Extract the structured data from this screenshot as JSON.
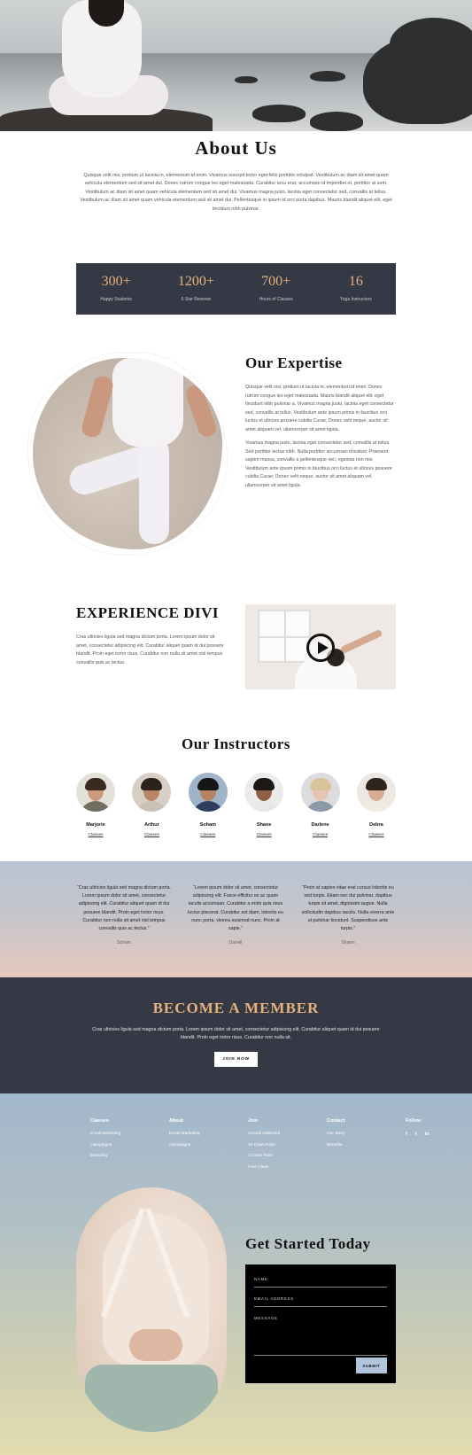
{
  "about": {
    "title": "About Us",
    "text": "Quisque velit nisi, pretium ut lacinia in, elementum id enim. Vivamus suscipit tortor eget felis porttitor volutpat. Vestibulum ac diam sit amet quam vehicula elementum sed sit amet dui. Donec rutrum congue leo eget malesuada. Curabitur arcu erat, accumsan id imperdiet et, porttitor at sem. Vestibulum ac diam sit amet quam vehicula elementum sed sit amet dui. Vivamus magna justo, lacinia eget consectetur sed, convallis at tellus. Vestibulum ac diam sit amet quam vehicula elementum sed sit amet dui. Pellentesque in ipsum id orci porta dapibus. Mauris blandit aliquet elit, eget tincidunt nibh pulvinar."
  },
  "stats": [
    {
      "number": "300+",
      "label": "Happy Students"
    },
    {
      "number": "1200+",
      "label": "5 Star Reviews"
    },
    {
      "number": "700+",
      "label": "Hours of Classes"
    },
    {
      "number": "16",
      "label": "Yoga Instructors"
    }
  ],
  "expertise": {
    "title": "Our Expertise",
    "p1": "Quisque velit nisi, pretium ut lacinia in, elementum id enim. Donec rutrum congue leo eget malesuada. Mauris blandit aliquet elit, eget tincidunt nibh pulvinar a. Vivamus magna justo, lacinia eget consectetur sed, convallis at tellus. Vestibulum ante ipsum primis in faucibus orci luctus et ultrices posuere cubilia Curae; Donec velit neque, auctor sit amet aliquam vel, ullamcorper sit amet ligula.",
    "p2": "Vivamus magna justo, lacinia eget consectetur sed, convallis at tellus. Sed porttitor lectus nibh. Nulla porttitor accumsan tincidunt. Praesent sapien massa, convallis a pellentesque nec, egestas non nisi. Vestibulum ante ipsum primis in faucibus orci luctus et ultrices posuere cubilia Curae; Donec velit neque, auctor sit amet aliquam vel, ullamcorper sit amet ligula."
  },
  "experience": {
    "title": "Experience Divi",
    "text": "Cras ultricies ligula sed magna dictum porta. Lorem ipsum dolor sit amet, consectetur adipiscing elit. Curabitur aliquet quam id dui posuere blandit. Proin eget tortor risus. Curabitur non nulla sit amet nisl tempus convallis quis ac lectus."
  },
  "instructors": {
    "title": "Our Instructors",
    "link_label": "Classes",
    "people": [
      {
        "name": "Marjorie",
        "skin": "#c99a7e",
        "hair": "#3a2a20",
        "shirt": "#6f6e5f",
        "bg": "#e4e1da"
      },
      {
        "name": "Arthur",
        "skin": "#b98565",
        "hair": "#2b221d",
        "shirt": "#c9c2b4",
        "bg": "#d7cfc3"
      },
      {
        "name": "Soham",
        "skin": "#b88363",
        "hair": "#161616",
        "shirt": "#2f3e5e",
        "bg": "#9fb3c9"
      },
      {
        "name": "Shane",
        "skin": "#8e5f45",
        "hair": "#1e1714",
        "shirt": "#e9e6e6",
        "bg": "#ecebec"
      },
      {
        "name": "Darlene",
        "skin": "#e6c4b0",
        "hair": "#d9c39b",
        "shirt": "#8a9aa8",
        "bg": "#dcdcde"
      },
      {
        "name": "Debra",
        "skin": "#d8ab93",
        "hair": "#2e231d",
        "shirt": "#f1ebe6",
        "bg": "#eee8e3"
      }
    ]
  },
  "testimonials": [
    {
      "quote": "“Cras ultricies ligula sed magna dictum porta. Lorem ipsum dolor sit amet, consectetur adipiscing elit. Curabitur aliquet quam id dui posuere blandit. Proin eget tortor risus. Curabitur non nulla sit amet nisl tempus convallis quis ac lectus.”",
      "name": "Soham"
    },
    {
      "quote": "“Lorem ipsum dolor sit amet, consectetur adipiscing elit. Fusce efficitur ex ac quam iaculis accumsan. Curabitur a enim quis risus luctus placerat. Curabitur est diam, lobortis eu nunc porta, viverra euismod nunc. Proin at sapie.”",
      "name": "Darrell"
    },
    {
      "quote": "“Proin at sapien vitae erat cursus lobortis eu sed turpis. Etiam nec dui pulvinar, dapibus turpis sit amet, dignissim augue. Nulla sollicitudin dapibus iaculis. Nulla viverra ante ut pulvinar tincidunt. Suspendisse ante turpis.”",
      "name": "Shawn"
    }
  ],
  "member": {
    "title": "Become a Member",
    "text": "Cras ultricies ligula sed magna dictum porta. Lorem ipsum dolor sit amet, consectetur adipiscing elit. Curabitur aliquet quam id dui posuere blandit. Proin eget tortor risus. Curabitur non nulla sit.",
    "button": "JOIN NOW"
  },
  "footer": {
    "columns": [
      {
        "heading": "Classes",
        "items": [
          "Email Marketing",
          "Campaigns",
          "Branding"
        ]
      },
      {
        "heading": "About",
        "items": [
          "Email Marketing",
          "Campaigns"
        ]
      },
      {
        "heading": "Join",
        "items": [
          "Annual Unlimited",
          "10 Class Pass",
          "1 Class Pass",
          "Free Class"
        ]
      },
      {
        "heading": "Contact",
        "items": [
          "Our Story",
          "Benefits"
        ]
      }
    ],
    "follow": {
      "heading": "Follow",
      "icons": [
        {
          "name": "facebook-icon",
          "glyph": "f"
        },
        {
          "name": "twitter-icon",
          "glyph": "t"
        },
        {
          "name": "linkedin-icon",
          "glyph": "in"
        }
      ]
    }
  },
  "get_started": {
    "title": "Get Started Today",
    "name_label": "NAME",
    "email_label": "EMAIL ADDRESS",
    "message_label": "MESSAGE",
    "submit": "SUBMIT"
  },
  "colors": {
    "dark_band": "#353845",
    "accent_gold": "#e8b07a",
    "submit_blue": "#b1c6dc"
  }
}
